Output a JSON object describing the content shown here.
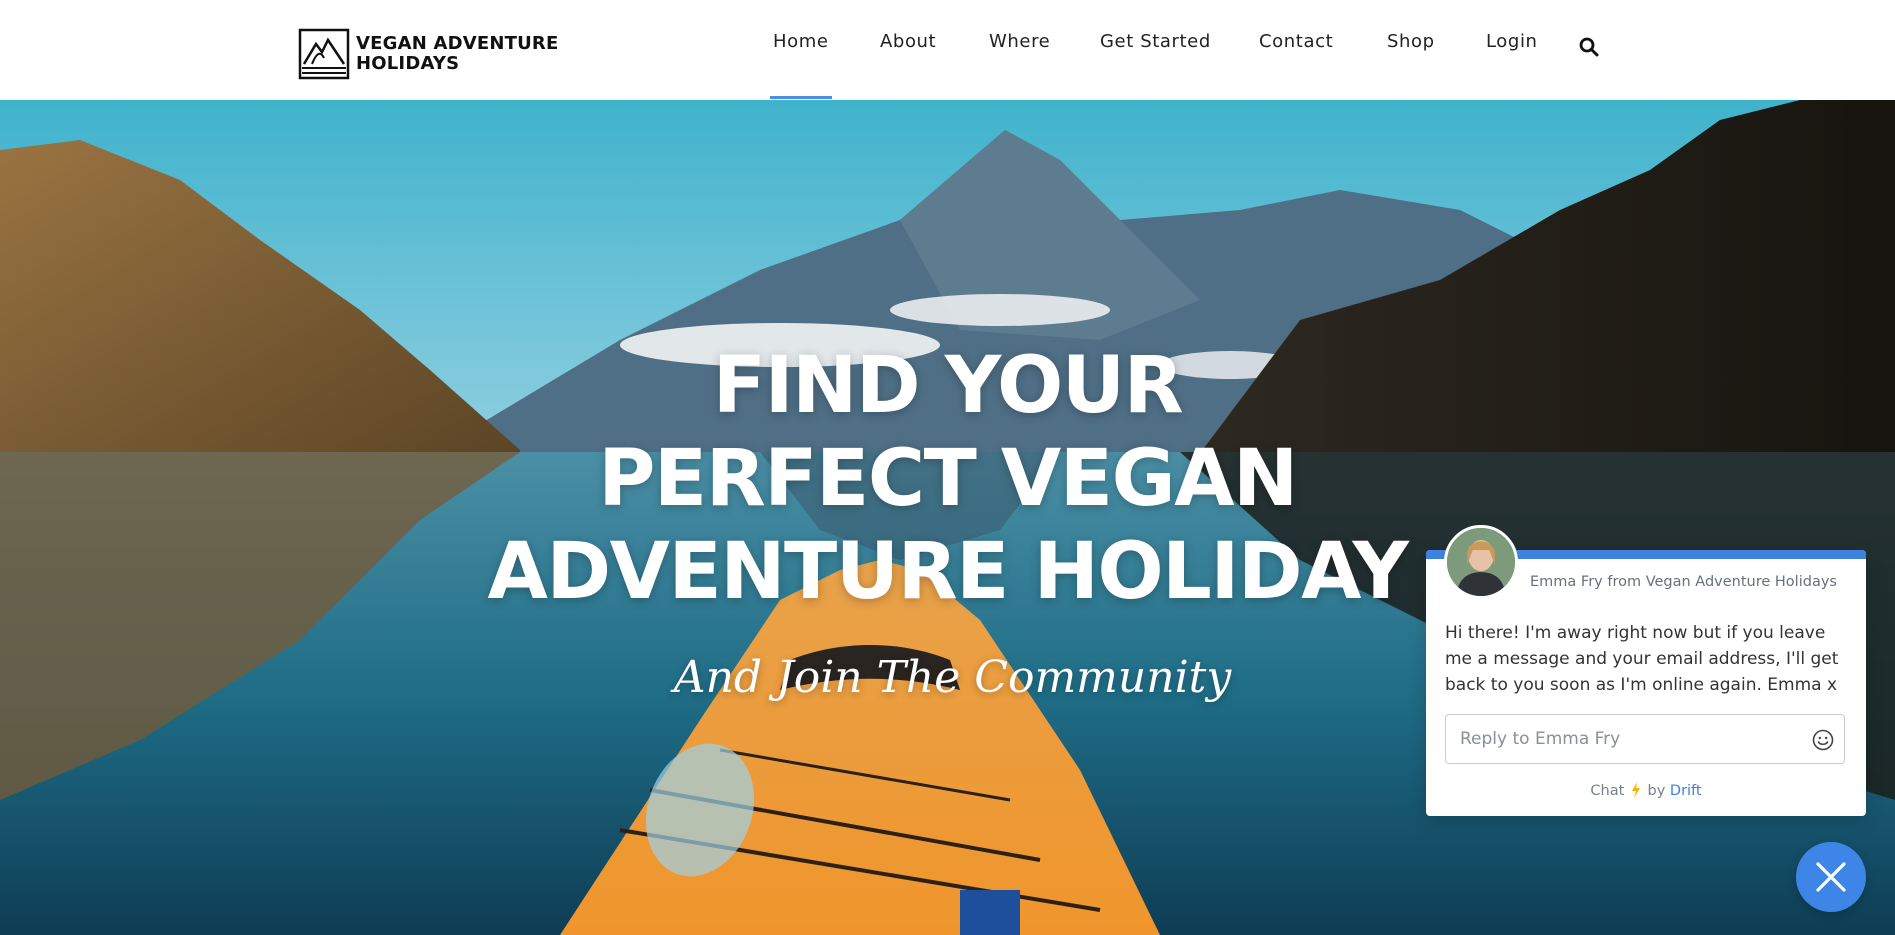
{
  "header": {
    "logo_line1": "VEGAN ADVENTURE",
    "logo_line2": "HOLIDAYS",
    "nav": [
      {
        "label": "Home",
        "active": true
      },
      {
        "label": "About"
      },
      {
        "label": "Where"
      },
      {
        "label": "Get Started"
      },
      {
        "label": "Contact"
      },
      {
        "label": "Shop"
      },
      {
        "label": "Login"
      }
    ],
    "search_icon": "search-icon",
    "accent_color": "#4a8fe0"
  },
  "hero": {
    "headline_lines": [
      "FIND YOUR",
      "PERFECT VEGAN",
      "ADVENTURE HOLIDAY"
    ],
    "subhead": "And Join The Community"
  },
  "chat": {
    "from": "Emma Fry from Vegan Adventure Holidays",
    "message": "Hi there! I'm away right now but if you leave me a message and your email address, I'll get back to you soon as I'm online again. Emma x",
    "input_placeholder": "Reply to Emma Fry",
    "input_value": "",
    "footer_prefix": "Chat",
    "footer_by": "by",
    "footer_brand": "Drift",
    "accent_color": "#3d82e0"
  }
}
